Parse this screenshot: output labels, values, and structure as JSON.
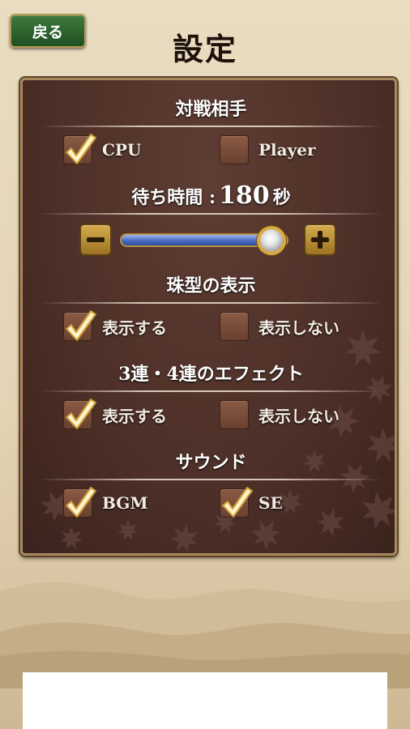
{
  "header": {
    "back_label": "戻る",
    "title": "設定"
  },
  "sections": {
    "opponent": {
      "title": "対戦相手",
      "options": [
        {
          "label": "CPU",
          "checked": true
        },
        {
          "label": "Player",
          "checked": false
        }
      ]
    },
    "wait_time": {
      "label": "待ち時間 :",
      "value": "180",
      "unit": "秒",
      "slider_fraction": 0.9
    },
    "orb_display": {
      "title": "珠型の表示",
      "options": [
        {
          "label": "表示する",
          "checked": true
        },
        {
          "label": "表示しない",
          "checked": false
        }
      ]
    },
    "combo_effect": {
      "title": "3連・4連のエフェクト",
      "options": [
        {
          "label": "表示する",
          "checked": true
        },
        {
          "label": "表示しない",
          "checked": false
        }
      ]
    },
    "sound": {
      "title": "サウンド",
      "options": [
        {
          "label": "BGM",
          "checked": true
        },
        {
          "label": "SE",
          "checked": true
        }
      ]
    }
  },
  "icons": {
    "check": "checkmark-icon",
    "minus": "minus-icon",
    "plus": "plus-icon"
  },
  "colors": {
    "panel": "#4c2f27",
    "accent_gold": "#d8a93e",
    "back_button": "#2e6a30"
  }
}
